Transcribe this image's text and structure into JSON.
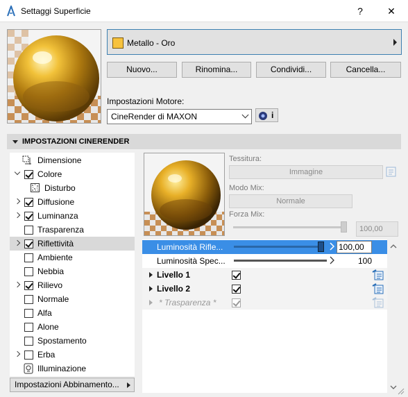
{
  "window": {
    "title": "Settaggi Superficie",
    "help": "?",
    "close": "✕"
  },
  "material": {
    "name": "Metallo - Oro",
    "swatch_color": "#f7c23d"
  },
  "buttons": {
    "new": "Nuovo...",
    "rename": "Rinomina...",
    "share": "Condividi...",
    "delete": "Cancella..."
  },
  "engine": {
    "label": "Impostazioni Motore:",
    "value": "CineRender di MAXON",
    "info": "i"
  },
  "section": {
    "title": "IMPOSTAZIONI CINERENDER"
  },
  "tree": [
    {
      "label": "Dimensione",
      "checkbox": "none",
      "expander": "none"
    },
    {
      "label": "Colore",
      "checkbox": "checked",
      "expander": "open"
    },
    {
      "label": "Disturbo",
      "checkbox": "none",
      "expander": "none"
    },
    {
      "label": "Diffusione",
      "checkbox": "checked",
      "expander": "closed"
    },
    {
      "label": "Luminanza",
      "checkbox": "checked",
      "expander": "closed"
    },
    {
      "label": "Trasparenza",
      "checkbox": "unchecked",
      "expander": "none"
    },
    {
      "label": "Riflettività",
      "checkbox": "checked",
      "expander": "closed"
    },
    {
      "label": "Ambiente",
      "checkbox": "unchecked",
      "expander": "none"
    },
    {
      "label": "Nebbia",
      "checkbox": "unchecked",
      "expander": "none"
    },
    {
      "label": "Rilievo",
      "checkbox": "checked",
      "expander": "closed"
    },
    {
      "label": "Normale",
      "checkbox": "unchecked",
      "expander": "none"
    },
    {
      "label": "Alfa",
      "checkbox": "unchecked",
      "expander": "none"
    },
    {
      "label": "Alone",
      "checkbox": "unchecked",
      "expander": "none"
    },
    {
      "label": "Spostamento",
      "checkbox": "unchecked",
      "expander": "none"
    },
    {
      "label": "Erba",
      "checkbox": "unchecked",
      "expander": "closed"
    },
    {
      "label": "Illuminazione",
      "checkbox": "none",
      "expander": "none"
    }
  ],
  "match_settings": "Impostazioni Abbinamento...",
  "texture": {
    "label": "Tessitura:",
    "value": "Immagine"
  },
  "mix_mode": {
    "label": "Modo Mix:",
    "value": "Normale"
  },
  "mix_strength": {
    "label": "Forza Mix:",
    "value": "100,00",
    "level": 1.0
  },
  "params": [
    {
      "label": "Luminosità Rifle...",
      "value": "100,00",
      "level": 1.0
    },
    {
      "label": "Luminosità Spec...",
      "value": "100",
      "level": 1.0
    }
  ],
  "layers": [
    {
      "label": "Livello 1",
      "checked": true,
      "enabled": true
    },
    {
      "label": "Livello 2",
      "checked": true,
      "enabled": true
    },
    {
      "label": "* Trasparenza *",
      "checked": true,
      "enabled": false
    }
  ]
}
